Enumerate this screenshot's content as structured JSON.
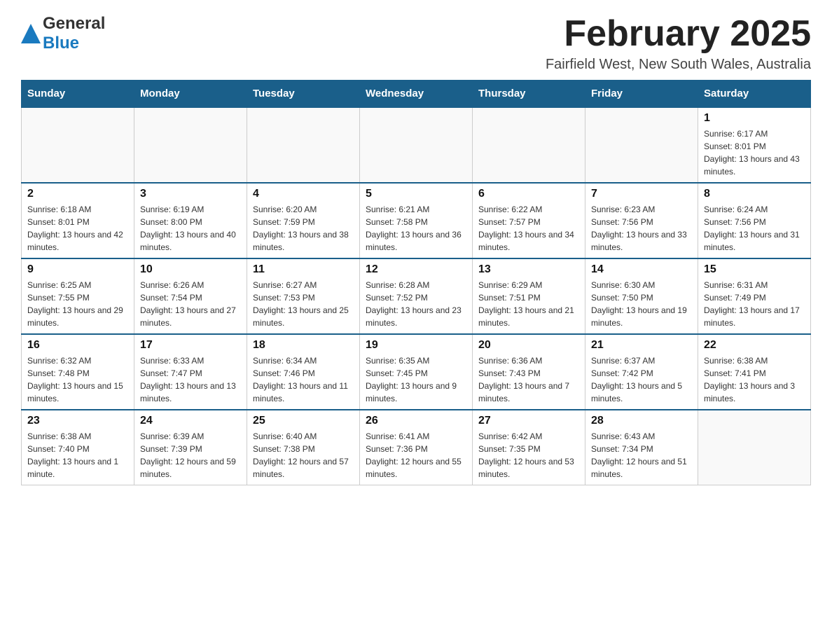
{
  "logo": {
    "line1": "General",
    "line2": "Blue",
    "arrow_color": "#1a7abf"
  },
  "title": "February 2025",
  "location": "Fairfield West, New South Wales, Australia",
  "days_of_week": [
    "Sunday",
    "Monday",
    "Tuesday",
    "Wednesday",
    "Thursday",
    "Friday",
    "Saturday"
  ],
  "weeks": [
    [
      {
        "day": "",
        "info": ""
      },
      {
        "day": "",
        "info": ""
      },
      {
        "day": "",
        "info": ""
      },
      {
        "day": "",
        "info": ""
      },
      {
        "day": "",
        "info": ""
      },
      {
        "day": "",
        "info": ""
      },
      {
        "day": "1",
        "info": "Sunrise: 6:17 AM\nSunset: 8:01 PM\nDaylight: 13 hours and 43 minutes."
      }
    ],
    [
      {
        "day": "2",
        "info": "Sunrise: 6:18 AM\nSunset: 8:01 PM\nDaylight: 13 hours and 42 minutes."
      },
      {
        "day": "3",
        "info": "Sunrise: 6:19 AM\nSunset: 8:00 PM\nDaylight: 13 hours and 40 minutes."
      },
      {
        "day": "4",
        "info": "Sunrise: 6:20 AM\nSunset: 7:59 PM\nDaylight: 13 hours and 38 minutes."
      },
      {
        "day": "5",
        "info": "Sunrise: 6:21 AM\nSunset: 7:58 PM\nDaylight: 13 hours and 36 minutes."
      },
      {
        "day": "6",
        "info": "Sunrise: 6:22 AM\nSunset: 7:57 PM\nDaylight: 13 hours and 34 minutes."
      },
      {
        "day": "7",
        "info": "Sunrise: 6:23 AM\nSunset: 7:56 PM\nDaylight: 13 hours and 33 minutes."
      },
      {
        "day": "8",
        "info": "Sunrise: 6:24 AM\nSunset: 7:56 PM\nDaylight: 13 hours and 31 minutes."
      }
    ],
    [
      {
        "day": "9",
        "info": "Sunrise: 6:25 AM\nSunset: 7:55 PM\nDaylight: 13 hours and 29 minutes."
      },
      {
        "day": "10",
        "info": "Sunrise: 6:26 AM\nSunset: 7:54 PM\nDaylight: 13 hours and 27 minutes."
      },
      {
        "day": "11",
        "info": "Sunrise: 6:27 AM\nSunset: 7:53 PM\nDaylight: 13 hours and 25 minutes."
      },
      {
        "day": "12",
        "info": "Sunrise: 6:28 AM\nSunset: 7:52 PM\nDaylight: 13 hours and 23 minutes."
      },
      {
        "day": "13",
        "info": "Sunrise: 6:29 AM\nSunset: 7:51 PM\nDaylight: 13 hours and 21 minutes."
      },
      {
        "day": "14",
        "info": "Sunrise: 6:30 AM\nSunset: 7:50 PM\nDaylight: 13 hours and 19 minutes."
      },
      {
        "day": "15",
        "info": "Sunrise: 6:31 AM\nSunset: 7:49 PM\nDaylight: 13 hours and 17 minutes."
      }
    ],
    [
      {
        "day": "16",
        "info": "Sunrise: 6:32 AM\nSunset: 7:48 PM\nDaylight: 13 hours and 15 minutes."
      },
      {
        "day": "17",
        "info": "Sunrise: 6:33 AM\nSunset: 7:47 PM\nDaylight: 13 hours and 13 minutes."
      },
      {
        "day": "18",
        "info": "Sunrise: 6:34 AM\nSunset: 7:46 PM\nDaylight: 13 hours and 11 minutes."
      },
      {
        "day": "19",
        "info": "Sunrise: 6:35 AM\nSunset: 7:45 PM\nDaylight: 13 hours and 9 minutes."
      },
      {
        "day": "20",
        "info": "Sunrise: 6:36 AM\nSunset: 7:43 PM\nDaylight: 13 hours and 7 minutes."
      },
      {
        "day": "21",
        "info": "Sunrise: 6:37 AM\nSunset: 7:42 PM\nDaylight: 13 hours and 5 minutes."
      },
      {
        "day": "22",
        "info": "Sunrise: 6:38 AM\nSunset: 7:41 PM\nDaylight: 13 hours and 3 minutes."
      }
    ],
    [
      {
        "day": "23",
        "info": "Sunrise: 6:38 AM\nSunset: 7:40 PM\nDaylight: 13 hours and 1 minute."
      },
      {
        "day": "24",
        "info": "Sunrise: 6:39 AM\nSunset: 7:39 PM\nDaylight: 12 hours and 59 minutes."
      },
      {
        "day": "25",
        "info": "Sunrise: 6:40 AM\nSunset: 7:38 PM\nDaylight: 12 hours and 57 minutes."
      },
      {
        "day": "26",
        "info": "Sunrise: 6:41 AM\nSunset: 7:36 PM\nDaylight: 12 hours and 55 minutes."
      },
      {
        "day": "27",
        "info": "Sunrise: 6:42 AM\nSunset: 7:35 PM\nDaylight: 12 hours and 53 minutes."
      },
      {
        "day": "28",
        "info": "Sunrise: 6:43 AM\nSunset: 7:34 PM\nDaylight: 12 hours and 51 minutes."
      },
      {
        "day": "",
        "info": ""
      }
    ]
  ]
}
